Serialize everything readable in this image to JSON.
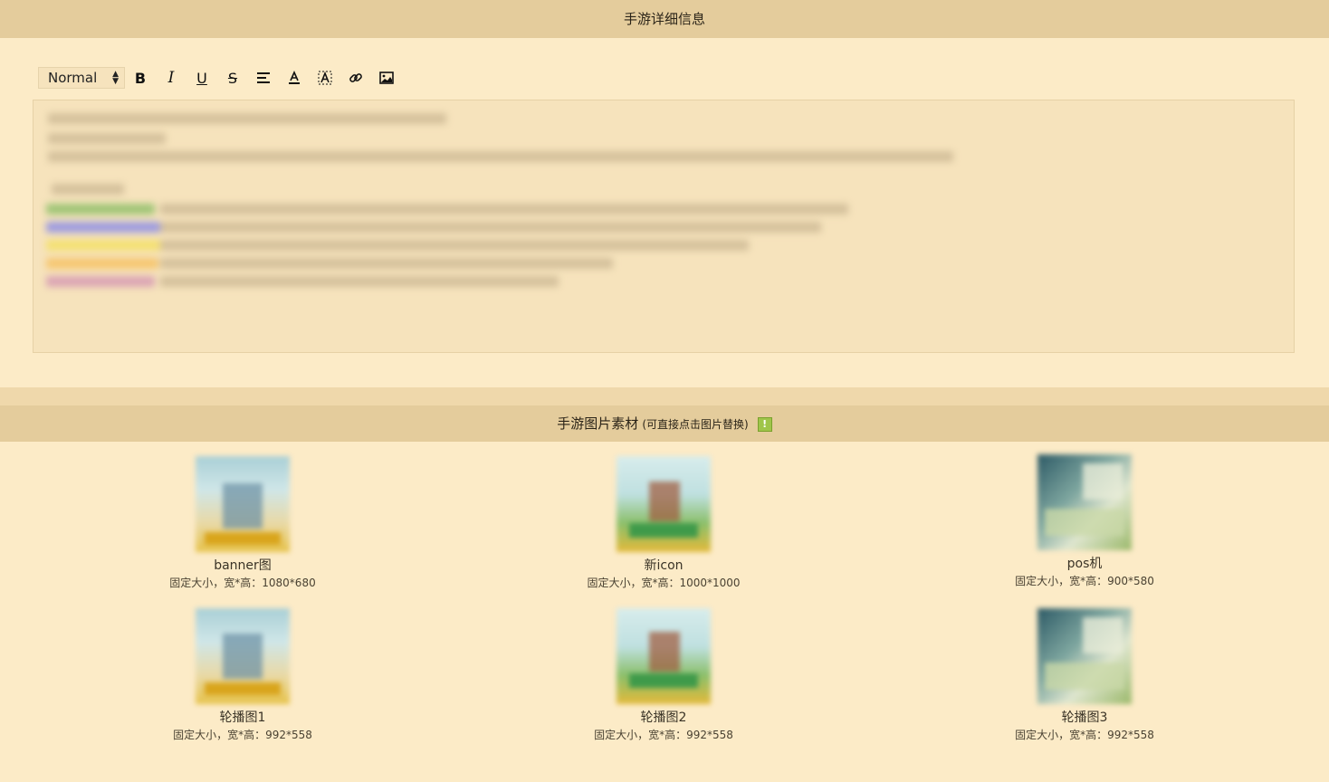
{
  "detail_section": {
    "title": "手游详细信息"
  },
  "toolbar": {
    "format_value": "Normal",
    "buttons": [
      {
        "name": "bold-button",
        "icon": "bold-icon",
        "glyph": "B"
      },
      {
        "name": "italic-button",
        "icon": "italic-icon",
        "glyph": "I"
      },
      {
        "name": "underline-button",
        "icon": "underline-icon",
        "glyph": "U"
      },
      {
        "name": "strike-button",
        "icon": "strikethrough-icon",
        "glyph": "S"
      },
      {
        "name": "align-button",
        "icon": "align-left-icon",
        "glyph": "≡"
      },
      {
        "name": "text-color-button",
        "icon": "text-color-icon",
        "glyph": "A"
      },
      {
        "name": "background-color-button",
        "icon": "background-color-icon",
        "glyph": "A"
      },
      {
        "name": "link-button",
        "icon": "link-icon",
        "glyph": "🔗"
      },
      {
        "name": "image-button",
        "icon": "image-icon",
        "glyph": "▣"
      }
    ]
  },
  "images_section": {
    "title": "手游图片素材",
    "hint": "(可直接点击图片替换)",
    "warn_icon": "warning-icon",
    "warn_glyph": "!"
  },
  "images": [
    {
      "name": "banner图",
      "size": "固定大小，宽*高：1080*680"
    },
    {
      "name": "新icon",
      "size": "固定大小，宽*高：1000*1000"
    },
    {
      "name": "pos机",
      "size": "固定大小，宽*高：900*580"
    },
    {
      "name": "轮播图1",
      "size": "固定大小，宽*高：992*558"
    },
    {
      "name": "轮播图2",
      "size": "固定大小，宽*高：992*558"
    },
    {
      "name": "轮播图3",
      "size": "固定大小，宽*高：992*558"
    }
  ],
  "colors": {
    "header_bg": "#e4cc9c",
    "page_bg": "#fcebc7",
    "editor_bg": "#f6e3bc"
  }
}
